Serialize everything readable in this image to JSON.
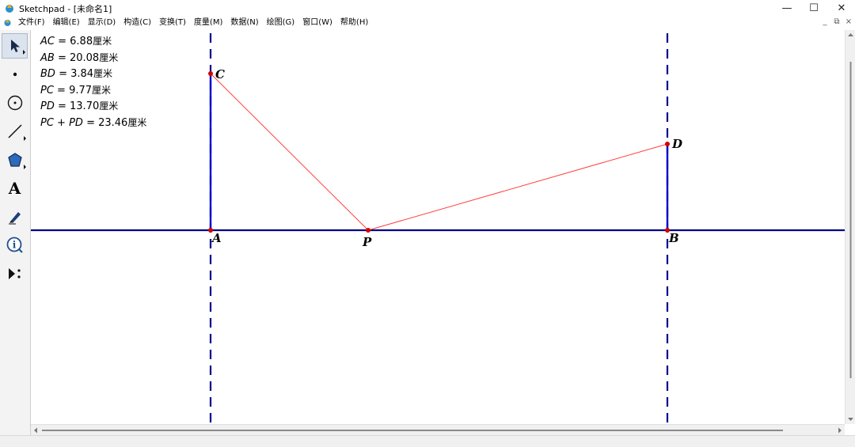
{
  "window": {
    "app_name": "Sketchpad",
    "doc_title": " - [未命名1]",
    "minimize": "—",
    "maximize": "☐",
    "close": "✕"
  },
  "menu": {
    "items": [
      "文件(F)",
      "编辑(E)",
      "显示(D)",
      "构造(C)",
      "变换(T)",
      "度量(M)",
      "数据(N)",
      "绘图(G)",
      "窗口(W)",
      "帮助(H)"
    ],
    "mdi_minimize": "_",
    "mdi_restore": "⧉",
    "mdi_close": "×"
  },
  "toolbox": {
    "tools": [
      {
        "name": "arrow-select-icon",
        "active": true
      },
      {
        "name": "point-tool-icon"
      },
      {
        "name": "compass-tool-icon"
      },
      {
        "name": "straightedge-tool-icon"
      },
      {
        "name": "polygon-tool-icon"
      },
      {
        "name": "text-tool-icon",
        "glyph": "A"
      },
      {
        "name": "marker-tool-icon"
      },
      {
        "name": "information-tool-icon",
        "glyph": "i"
      },
      {
        "name": "custom-tool-icon"
      }
    ]
  },
  "measurements": [
    {
      "label": "AC",
      "value": " = 6.88",
      "unit": "厘米"
    },
    {
      "label": "AB",
      "value": " = 20.08",
      "unit": "厘米"
    },
    {
      "label": "BD",
      "value": " = 3.84",
      "unit": "厘米"
    },
    {
      "label": "PC",
      "value": " = 9.77",
      "unit": "厘米"
    },
    {
      "label": "PD",
      "value": " = 13.70",
      "unit": "厘米"
    },
    {
      "label": "PC + PD",
      "value": " = 23.46",
      "unit": "厘米"
    }
  ],
  "points": {
    "A": "A",
    "B": "B",
    "C": "C",
    "D": "D",
    "P": "P"
  },
  "colors": {
    "axis_line": "#00008b",
    "perpendicular": "#0000cd",
    "segment": "#ff4040",
    "point": "#d40000"
  }
}
